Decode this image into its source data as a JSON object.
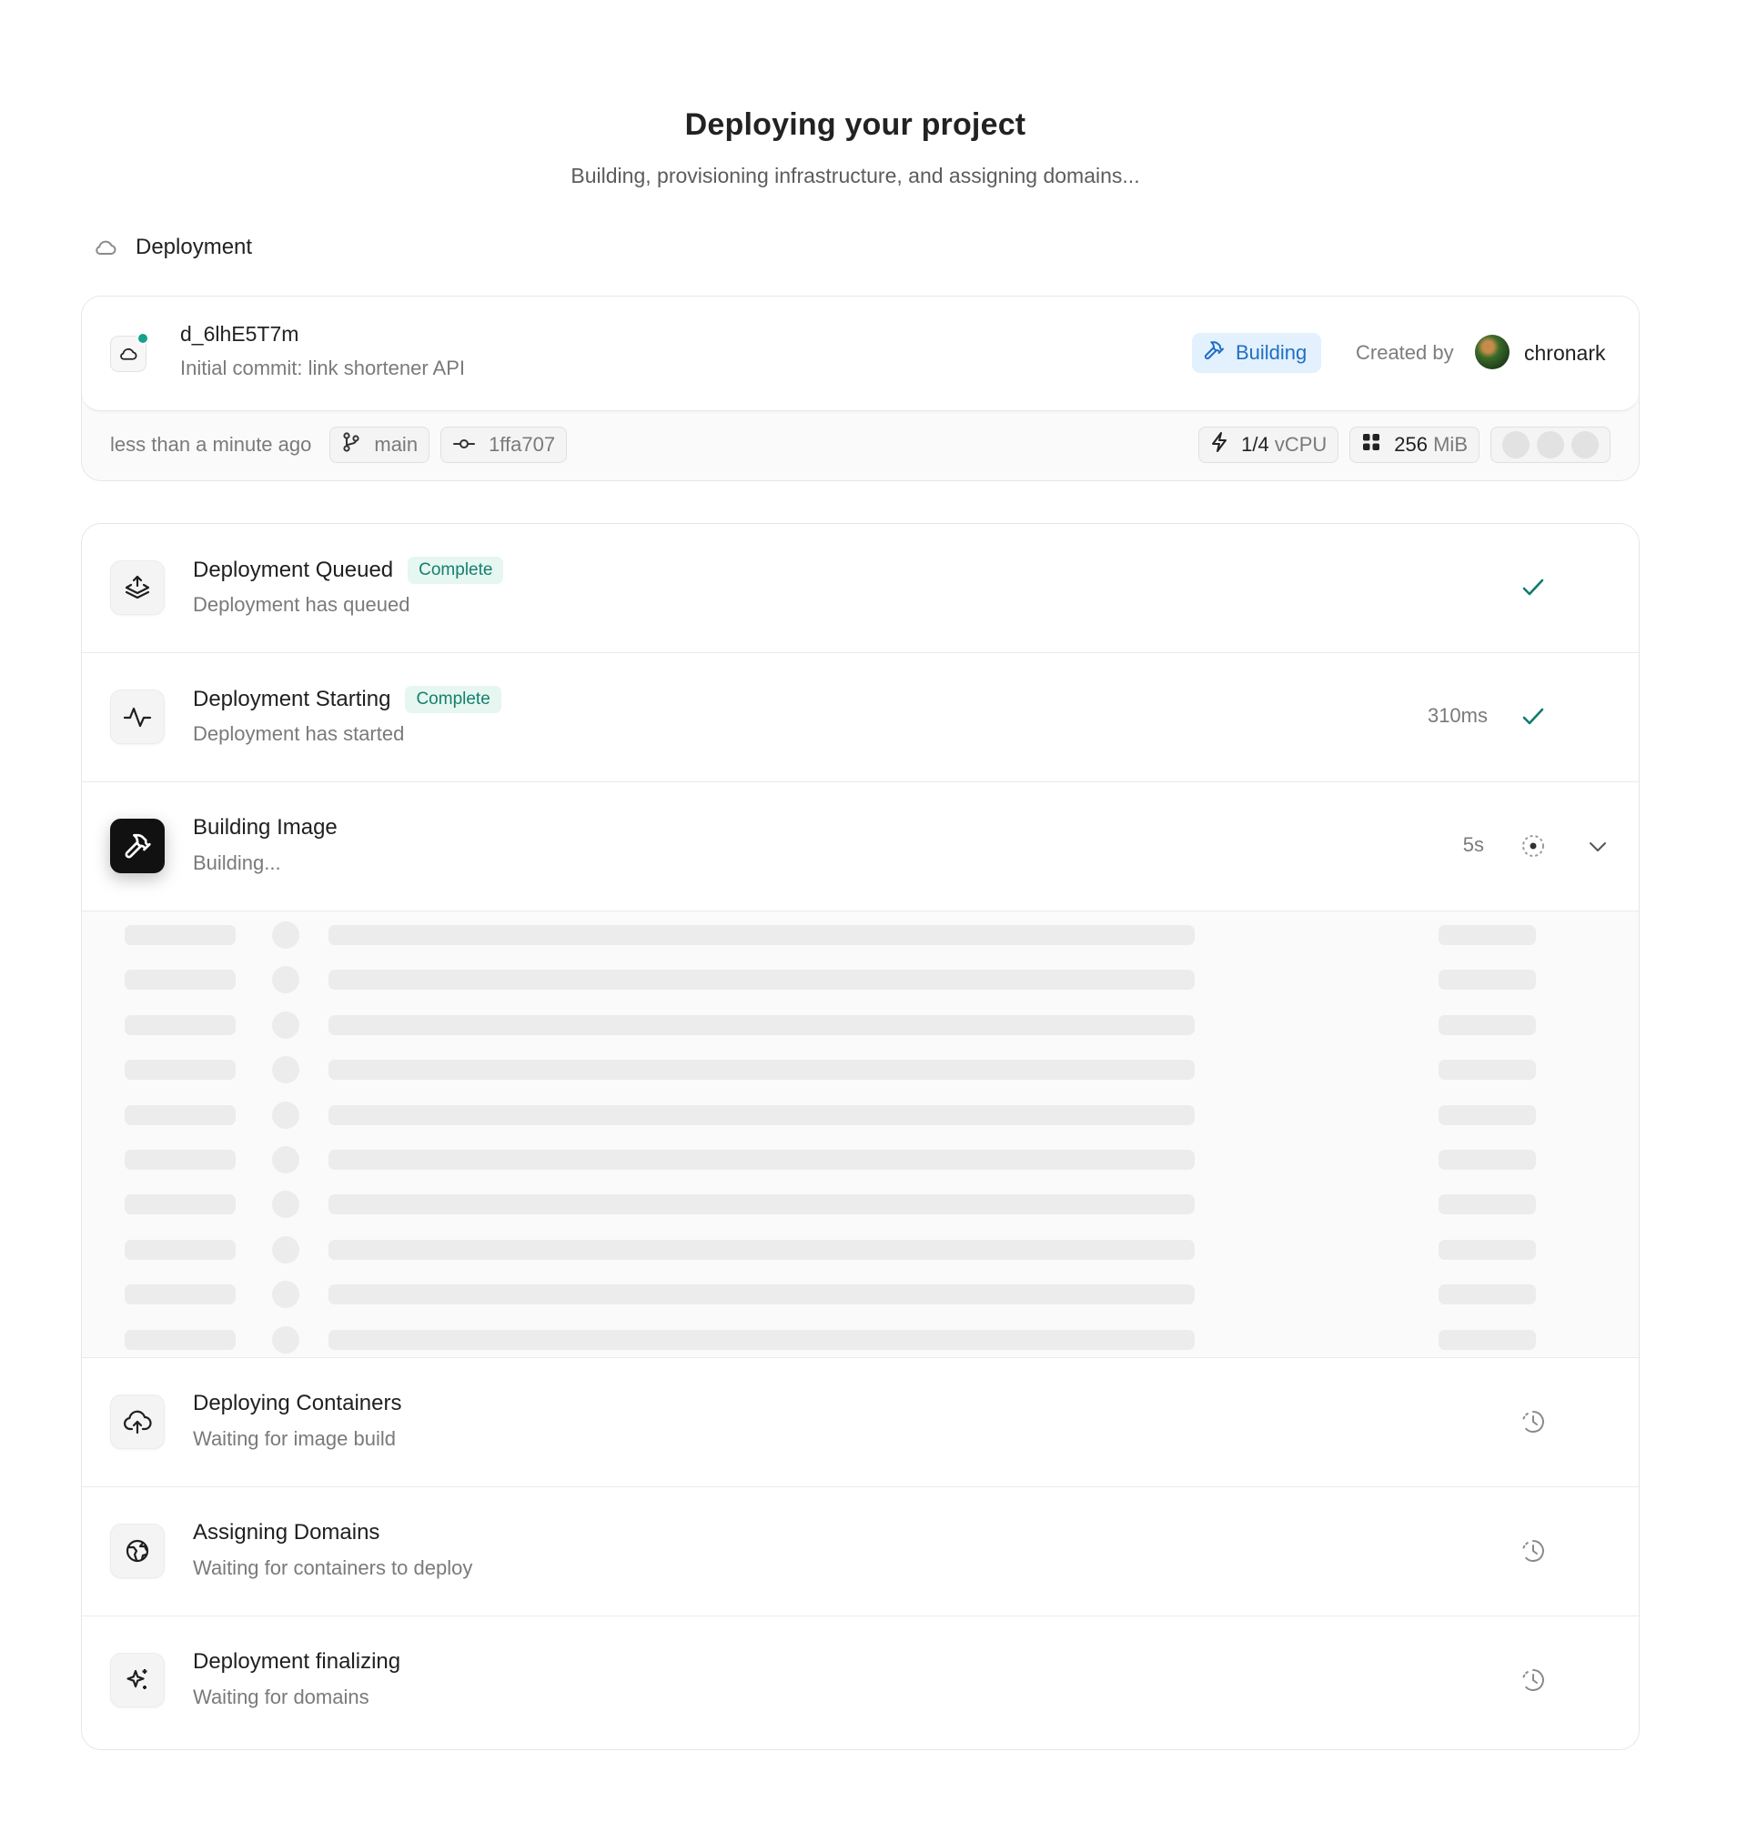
{
  "header": {
    "title": "Deploying your project",
    "subtitle": "Building, provisioning infrastructure, and assigning domains..."
  },
  "section": {
    "label": "Deployment",
    "icon": "cloud-icon"
  },
  "deployment": {
    "id": "d_6lhE5T7m",
    "commit_message": "Initial commit: link shortener API",
    "status": "Building",
    "created_by_label": "Created by",
    "username": "chronark",
    "time_ago": "less than a minute ago",
    "branch": "main",
    "commit_sha": "1ffa707",
    "cpu_value": "1/4",
    "cpu_unit": "vCPU",
    "memory_value": "256",
    "memory_unit": "MiB",
    "status_color": "#14a28b"
  },
  "steps": [
    {
      "title": "Deployment Queued",
      "badge": "Complete",
      "description": "Deployment has queued",
      "duration": "",
      "icon": "upload-stack-icon",
      "state": "complete"
    },
    {
      "title": "Deployment Starting",
      "badge": "Complete",
      "description": "Deployment has started",
      "duration": "310ms",
      "icon": "activity-icon",
      "state": "complete"
    },
    {
      "title": "Building Image",
      "badge": "",
      "description": "Building...",
      "duration": "5s",
      "icon": "hammer-icon",
      "state": "in-progress"
    },
    {
      "title": "Deploying Containers",
      "badge": "",
      "description": "Waiting for image build",
      "duration": "",
      "icon": "cloud-upload-icon",
      "state": "pending"
    },
    {
      "title": "Assigning Domains",
      "badge": "",
      "description": "Waiting for containers to deploy",
      "duration": "",
      "icon": "globe-icon",
      "state": "pending"
    },
    {
      "title": "Deployment finalizing",
      "badge": "",
      "description": "Waiting for domains",
      "duration": "",
      "icon": "sparkle-icon",
      "state": "pending"
    }
  ],
  "colors": {
    "accent_blue": "#1f6fc4",
    "success_green": "#14806d",
    "check_teal": "#0f7c6c"
  }
}
